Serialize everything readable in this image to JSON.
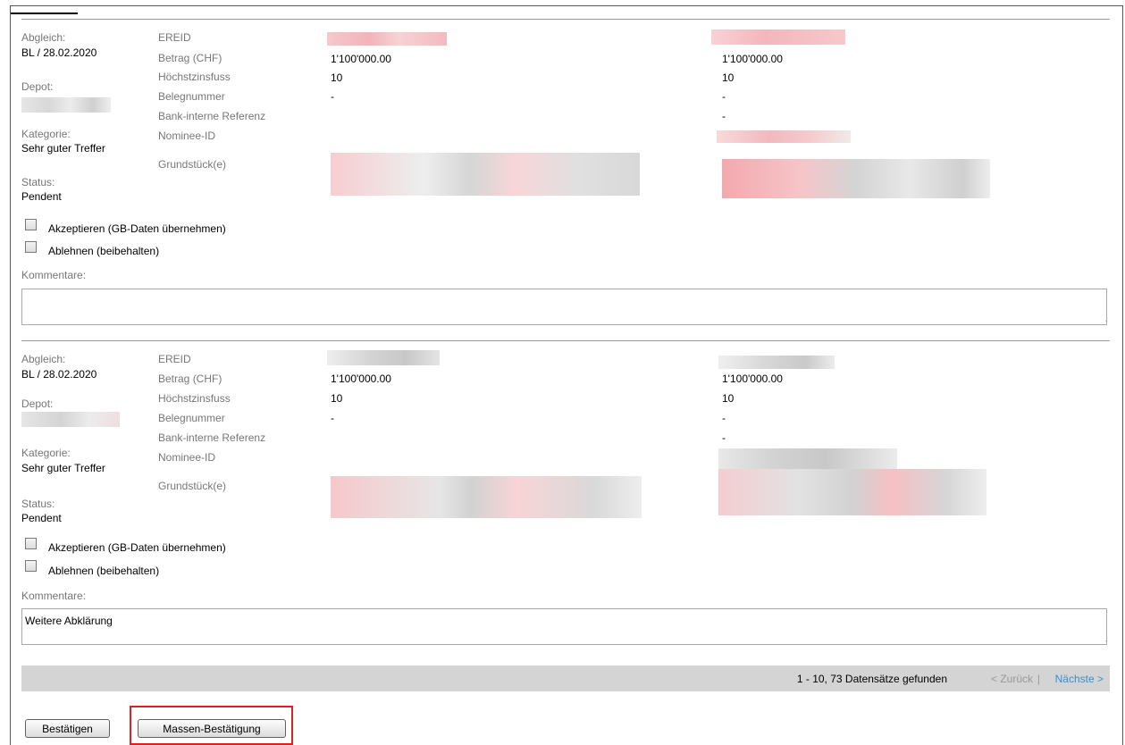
{
  "records": [
    {
      "abgleich_label": "Abgleich:",
      "abgleich_value": "BL / 28.02.2020",
      "depot_label": "Depot:",
      "kategorie_label": "Kategorie:",
      "kategorie_value": "Sehr guter Treffer",
      "status_label": "Status:",
      "status_value": "Pendent",
      "field_labels": [
        "EREID",
        "Betrag (CHF)",
        "Höchstzinsfuss",
        "Belegnummer",
        "Bank-interne Referenz",
        "Nominee-ID",
        "Grundstück(e)"
      ],
      "left_values": {
        "betrag": "1'100'000.00",
        "zins": "10",
        "beleg": "-"
      },
      "right_values": {
        "betrag": "1'100'000.00",
        "zins": "10",
        "beleg": "-",
        "referenz": "-"
      },
      "accept_label": "Akzeptieren (GB-Daten übernehmen)",
      "reject_label": "Ablehnen (beibehalten)",
      "comment_label": "Kommentare:",
      "comment_value": ""
    },
    {
      "abgleich_label": "Abgleich:",
      "abgleich_value": "BL / 28.02.2020",
      "depot_label": "Depot:",
      "kategorie_label": "Kategorie:",
      "kategorie_value": "Sehr guter Treffer",
      "status_label": "Status:",
      "status_value": "Pendent",
      "field_labels": [
        "EREID",
        "Betrag (CHF)",
        "Höchstzinsfuss",
        "Belegnummer",
        "Bank-interne Referenz",
        "Nominee-ID",
        "Grundstück(e)"
      ],
      "left_values": {
        "betrag": "1'100'000.00",
        "zins": "10",
        "beleg": "-"
      },
      "right_values": {
        "betrag": "1'100'000.00",
        "zins": "10",
        "beleg": "-",
        "referenz": "-"
      },
      "accept_label": "Akzeptieren (GB-Daten übernehmen)",
      "reject_label": "Ablehnen (beibehalten)",
      "comment_label": "Kommentare:",
      "comment_value": "Weitere Abklärung"
    }
  ],
  "pager": {
    "count_text": "1 - 10, 73 Datensätze gefunden",
    "prev_label": "< Zurück",
    "separator": "|",
    "next_label": "Nächste >"
  },
  "buttons": {
    "confirm_label": "Bestätigen",
    "mass_confirm_label": "Massen-Bestätigung"
  },
  "colors": {
    "link": "#3a8fd0",
    "highlight": "#e02020",
    "pager_bg": "#d4d4d4"
  }
}
